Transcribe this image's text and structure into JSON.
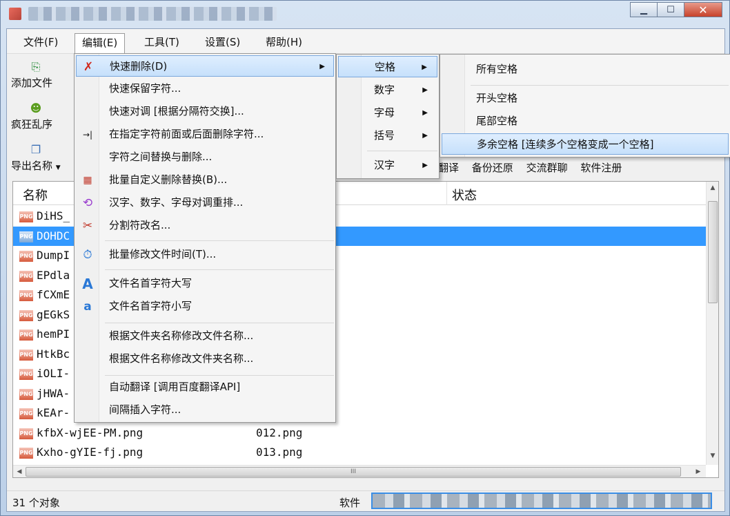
{
  "menubar": {
    "items": [
      "文件(F)",
      "编辑(E)",
      "工具(T)",
      "设置(S)",
      "帮助(H)"
    ]
  },
  "toolbar": {
    "add_files": "添加文件",
    "crazy": "疯狂乱序",
    "export_names": "导出名称",
    "right_items": [
      "翻译",
      "备份还原",
      "交流群聊",
      "软件注册"
    ]
  },
  "list": {
    "headers": {
      "name": "名称",
      "status": "状态"
    },
    "rows": [
      {
        "name": "DiHS_",
        "new": "",
        "selected": false
      },
      {
        "name": "DOHDC",
        "new": "",
        "selected": true
      },
      {
        "name": "DumpI",
        "new": "",
        "selected": false
      },
      {
        "name": "EPdla",
        "new": "",
        "selected": false
      },
      {
        "name": "fCXmE",
        "new": "",
        "selected": false
      },
      {
        "name": "gEGkS",
        "new": "",
        "selected": false
      },
      {
        "name": "hemPI",
        "new": "",
        "selected": false
      },
      {
        "name": "HtkBc",
        "new": "",
        "selected": false
      },
      {
        "name": "iOLI-",
        "new": "",
        "selected": false
      },
      {
        "name": "jHWA-",
        "new": "",
        "selected": false
      },
      {
        "name": "kEAr-",
        "new": "",
        "selected": false
      },
      {
        "name": "kfbX-wjEE-PM.png",
        "new": "012.png",
        "selected": false
      },
      {
        "name": "Kxho-gYIE-fj.png",
        "new": "013.png",
        "selected": false
      }
    ],
    "scroll_glyph": "III"
  },
  "status": {
    "count": "31 个对象",
    "software": "软件"
  },
  "edit_menu": {
    "items": [
      {
        "label": "快速删除(D)",
        "icon": "red-x-icon",
        "submenu": true
      },
      {
        "label": "快速保留字符..."
      },
      {
        "label": "快速对调 [根据分隔符交换]..."
      },
      {
        "label": "在指定字符前面或后面删除字符...",
        "icon": "arrow-bar-icon"
      },
      {
        "label": "字符之间替换与删除..."
      },
      {
        "label": "批量自定义删除替换(B)...",
        "icon": "batch-replace-icon"
      },
      {
        "label": "汉字、数字、字母对调重排...",
        "icon": "shuffle-icon"
      },
      {
        "label": "分割符改名...",
        "icon": "scissors-icon"
      },
      {
        "label": "批量修改文件时间(T)...",
        "icon": "clock-icon"
      },
      {
        "label": "文件名首字符大写",
        "icon": "uppercase-a-icon"
      },
      {
        "label": "文件名首字符小写",
        "icon": "lowercase-a-icon"
      },
      {
        "label": "根据文件夹名称修改文件名称..."
      },
      {
        "label": "根据文件名称修改文件夹名称..."
      },
      {
        "label": "自动翻译 [调用百度翻译API]"
      },
      {
        "label": "间隔插入字符..."
      }
    ]
  },
  "quick_delete_menu": {
    "items": [
      "空格",
      "数字",
      "字母",
      "括号",
      "汉字"
    ]
  },
  "space_menu": {
    "items": [
      "所有空格",
      "开头空格",
      "尾部空格",
      "多余空格 [连续多个空格变成一个空格]"
    ]
  },
  "colors": {
    "selection": "#3399ff",
    "highlight_border": "#7aa7dc"
  }
}
